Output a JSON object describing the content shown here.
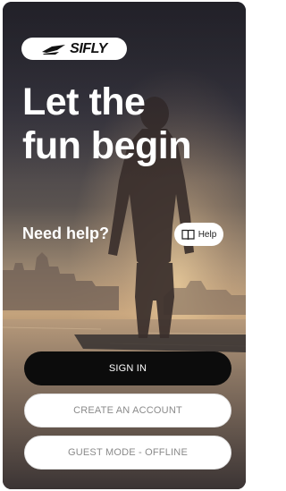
{
  "brand": {
    "logo_text": "SIFLY"
  },
  "hero": {
    "line1": "Let the",
    "line2": "fun begin"
  },
  "help": {
    "prompt": "Need help?",
    "button_label": "Help"
  },
  "actions": {
    "sign_in": "SIGN IN",
    "create_account": "CREATE AN ACCOUNT",
    "guest_mode": "GUEST MODE - OFFLINE"
  },
  "colors": {
    "primary_button": "#0c0c0c",
    "secondary_button": "#ffffff",
    "secondary_text": "#8a8a8a",
    "headline": "#ffffff"
  },
  "icons": {
    "help": "book-icon",
    "logo": "sifly-logo-mark"
  }
}
